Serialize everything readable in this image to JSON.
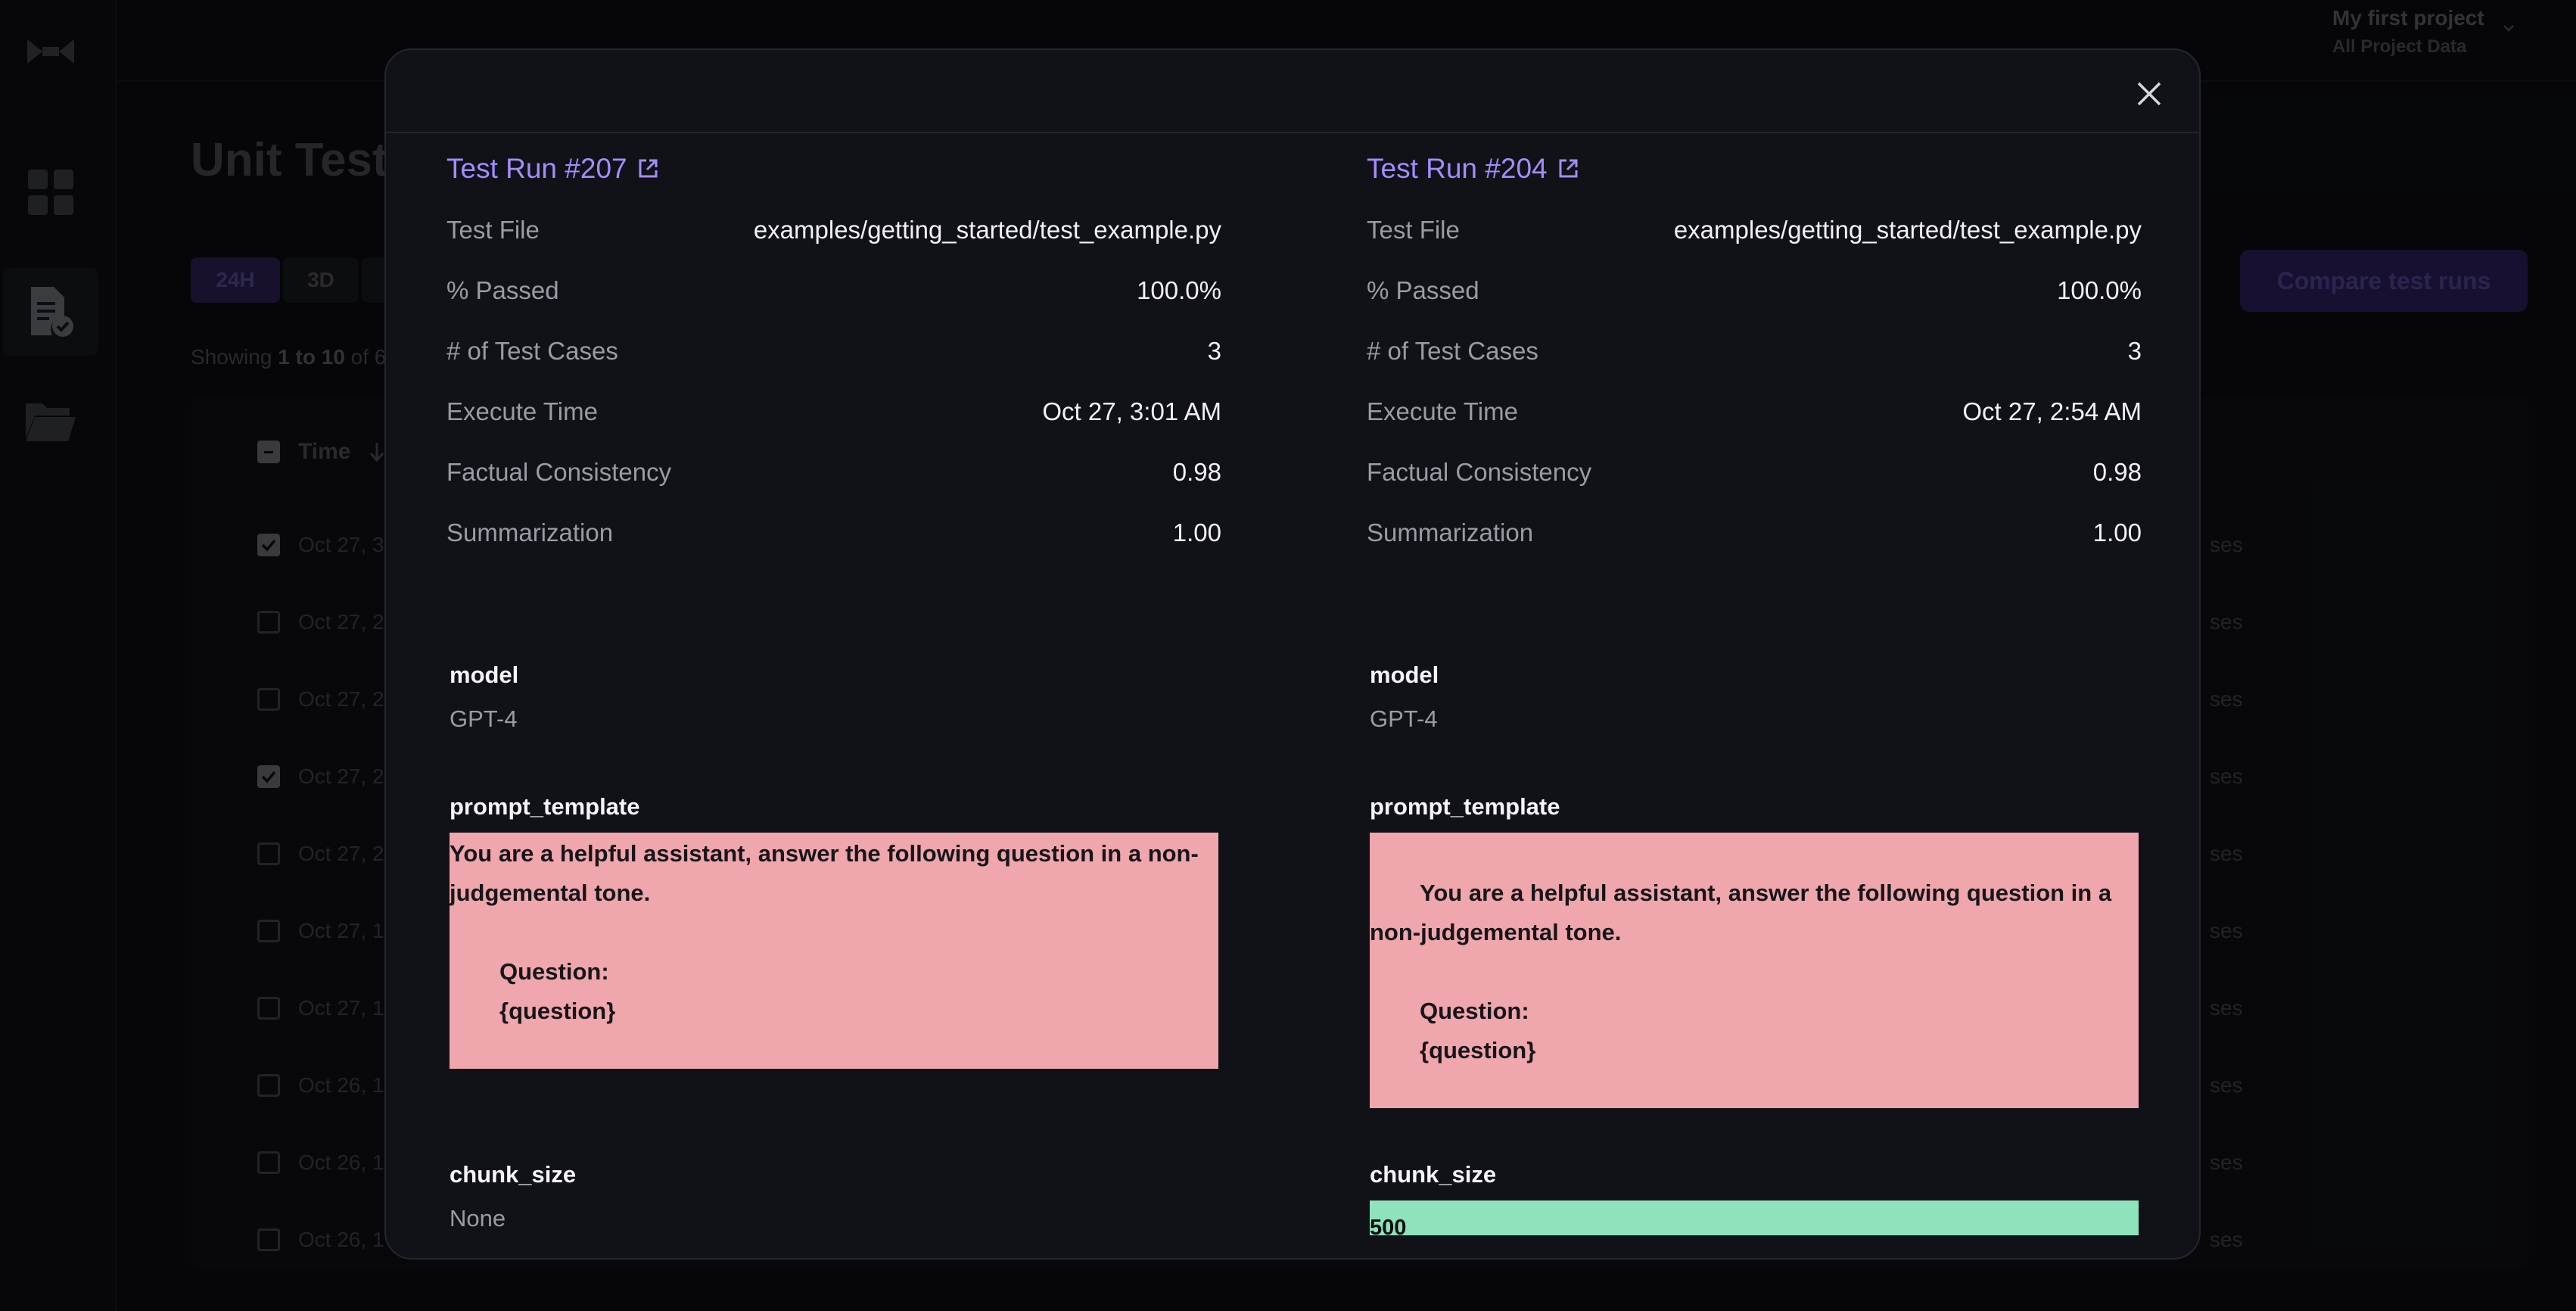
{
  "app": {
    "project_name": "My first project",
    "project_sub": "All Project Data",
    "page_title": "Unit Tests",
    "range_24h": "24H",
    "range_3d": "3D",
    "compare_button": "Compare test runs",
    "showing_prefix": "Showing",
    "showing_range": "1 to 10",
    "showing_suffix": "of 6",
    "table_header_time": "Time",
    "rows": [
      {
        "time": "Oct 27, 3",
        "cases": "ses",
        "checked": true
      },
      {
        "time": "Oct 27, 2",
        "cases": "ses",
        "checked": false
      },
      {
        "time": "Oct 27, 2",
        "cases": "ses",
        "checked": false
      },
      {
        "time": "Oct 27, 2",
        "cases": "ses",
        "checked": true
      },
      {
        "time": "Oct 27, 2",
        "cases": "ses",
        "checked": false
      },
      {
        "time": "Oct 27, 1",
        "cases": "ses",
        "checked": false
      },
      {
        "time": "Oct 27, 1",
        "cases": "ses",
        "checked": false
      },
      {
        "time": "Oct 26, 1",
        "cases": "ses",
        "checked": false
      },
      {
        "time": "Oct 26, 1",
        "cases": "ses",
        "checked": false
      },
      {
        "time": "Oct 26, 1",
        "cases": "ses",
        "checked": false
      }
    ]
  },
  "modal": {
    "left": {
      "title": "Test Run #207",
      "stats": {
        "test_file_label": "Test File",
        "test_file": "examples/getting_started/test_example.py",
        "passed_label": "% Passed",
        "passed": "100.0%",
        "cases_label": "# of Test Cases",
        "cases": "3",
        "exec_label": "Execute Time",
        "exec": "Oct 27, 3:01 AM",
        "fact_label": "Factual Consistency",
        "fact": "0.98",
        "summ_label": "Summarization",
        "summ": "1.00"
      },
      "model_label": "model",
      "model": "GPT-4",
      "prompt_label": "prompt_template",
      "prompt_l1": "You are a helpful assistant, answer the following question in a non-",
      "prompt_l2": "judgemental tone.",
      "prompt_l3": "Question:",
      "prompt_l4": "{question}",
      "chunk_label": "chunk_size",
      "chunk": "None"
    },
    "right": {
      "title": "Test Run #204",
      "stats": {
        "test_file_label": "Test File",
        "test_file": "examples/getting_started/test_example.py",
        "passed_label": "% Passed",
        "passed": "100.0%",
        "cases_label": "# of Test Cases",
        "cases": "3",
        "exec_label": "Execute Time",
        "exec": "Oct 27, 2:54 AM",
        "fact_label": "Factual Consistency",
        "fact": "0.98",
        "summ_label": "Summarization",
        "summ": "1.00"
      },
      "model_label": "model",
      "model": "GPT-4",
      "prompt_label": "prompt_template",
      "prompt_l1": "You are a helpful assistant, answer the following question in a",
      "prompt_l2": "non-judgemental tone.",
      "prompt_l3": "Question:",
      "prompt_l4": "{question}",
      "chunk_label": "chunk_size",
      "chunk": "500"
    }
  },
  "colors": {
    "accent_link": "#a48cff",
    "diff_removed": "#f0a6ad",
    "diff_added": "#8fe3bc"
  }
}
